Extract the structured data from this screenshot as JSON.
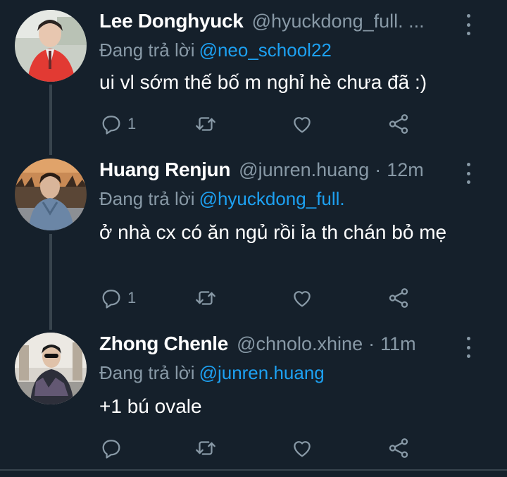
{
  "reply_prefix": "Đang trả lời",
  "tweets": [
    {
      "name": "Lee Donghyuck",
      "handle": "@hyuckdong_full. ...",
      "time": "",
      "reply_to": "@neo_school22",
      "text": "ui vl sớm thế bố m nghỉ hè chưa đã :)",
      "reply_count": "1"
    },
    {
      "name": "Huang Renjun",
      "handle": "@junren.huang",
      "time": "12m",
      "reply_to": "@hyuckdong_full.",
      "text": "ở nhà cx có ăn ngủ rồi ỉa th chán bỏ mẹ",
      "reply_count": "1"
    },
    {
      "name": "Zhong Chenle",
      "handle": "@chnolo.xhine",
      "time": "11m",
      "reply_to": "@junren.huang",
      "text": "+1 bú ovale",
      "reply_count": ""
    }
  ],
  "colors": {
    "background": "#15202b",
    "secondary_text": "#8899a6",
    "mention": "#1da1f2",
    "thread_line": "#38444d"
  },
  "icons": [
    "reply-icon",
    "retweet-icon",
    "like-icon",
    "share-icon",
    "more-icon"
  ]
}
